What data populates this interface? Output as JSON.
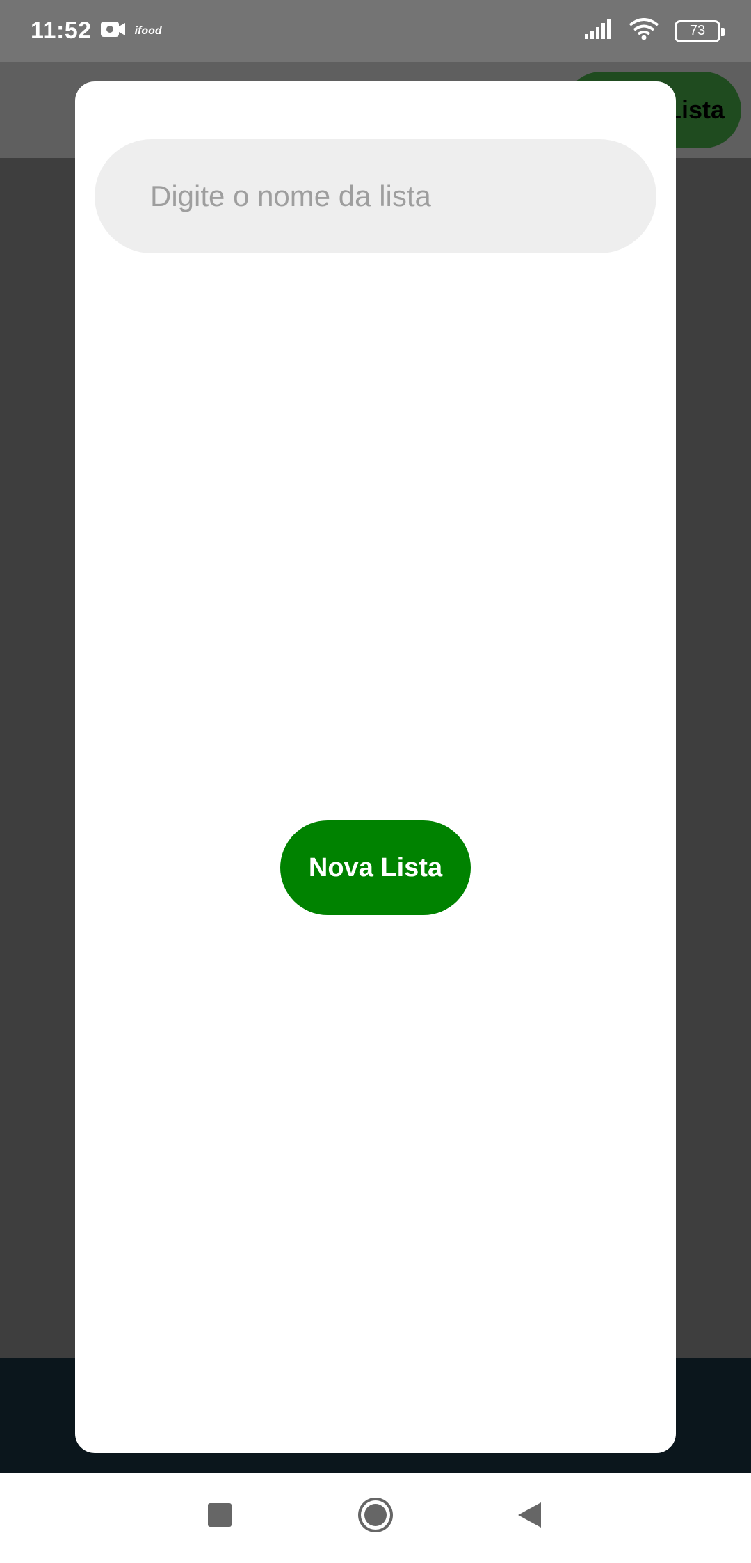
{
  "status_bar": {
    "time": "11:52",
    "notification_app": "ifood",
    "battery_level": "73"
  },
  "background_app": {
    "header_button_label": "Lista"
  },
  "dialog": {
    "input": {
      "value": "",
      "placeholder": "Digite o nome da lista"
    },
    "new_list_button_label": "Nova Lista"
  },
  "colors": {
    "accent_green": "#008200",
    "input_background": "#eeeeee",
    "scrim": "#3e3e3e",
    "bottom_bar": "#0b161c"
  },
  "nav_bar": {
    "recents_icon": "square-icon",
    "home_icon": "circle-icon",
    "back_icon": "triangle-back-icon"
  }
}
